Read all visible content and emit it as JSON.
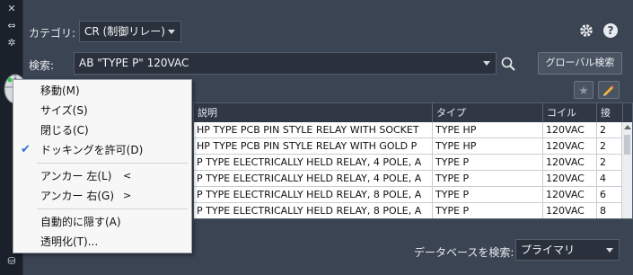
{
  "category": {
    "label": "カテゴリ:",
    "value": "CR (制御リレー)"
  },
  "search": {
    "label": "検索:",
    "value": "AB \"TYPE P\" 120VAC",
    "global_button": "グローバル検索"
  },
  "table": {
    "columns": [
      "説明",
      "タイプ",
      "コイル",
      "接"
    ],
    "rows": [
      [
        "HP TYPE PCB PIN STYLE RELAY WITH SOCKET",
        "TYPE HP",
        "120VAC",
        "2"
      ],
      [
        "HP TYPE PCB PIN STYLE RELAY WITH GOLD P",
        "TYPE HP",
        "120VAC",
        "2"
      ],
      [
        "P TYPE ELECTRICALLY HELD RELAY, 4 POLE, A",
        "TYPE P",
        "120VAC",
        "2"
      ],
      [
        "P TYPE ELECTRICALLY HELD RELAY, 4 POLE, A",
        "TYPE P",
        "120VAC",
        "4"
      ],
      [
        "P TYPE ELECTRICALLY HELD RELAY, 8 POLE, A",
        "TYPE P",
        "120VAC",
        "6"
      ],
      [
        "P TYPE ELECTRICALLY HELD RELAY, 8 POLE, A",
        "TYPE P",
        "120VAC",
        "8"
      ]
    ]
  },
  "context_menu": {
    "items": [
      "移動(M)",
      "サイズ(S)",
      "閉じる(C)",
      "ドッキングを許可(D)",
      "アンカー 左(L)",
      "アンカー 右(G)",
      "自動的に隠す(A)",
      "透明化(T)..."
    ],
    "arrows": [
      "<",
      ">"
    ],
    "checked_item": "ドッキングを許可(D)"
  },
  "database": {
    "label": "データベースを検索:",
    "value": "プライマリ"
  },
  "colors": {
    "accent": "#2a6fd6",
    "panel": "#3b4453",
    "header": "#303845"
  },
  "icons": [
    "close-icon",
    "pin-icon",
    "settings-icon",
    "help-icon",
    "magnifier-icon",
    "star-icon",
    "pencil-icon",
    "mouse-icon"
  ]
}
